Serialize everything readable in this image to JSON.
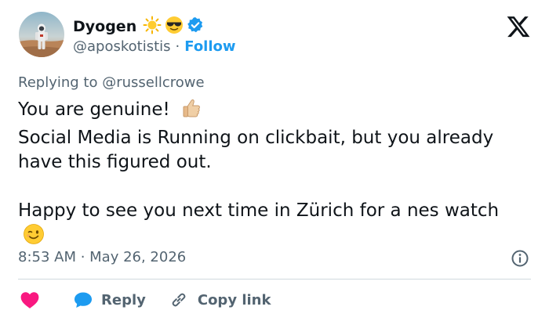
{
  "author": {
    "display_name": "Dyogen",
    "name_emojis": [
      "sun-icon",
      "sunglasses-face-icon"
    ],
    "verified": true,
    "handle": "@aposkotistis",
    "separator": "·",
    "follow_label": "Follow"
  },
  "reply_context": {
    "prefix": "Replying to",
    "mention": "@russellcrowe"
  },
  "tweet": {
    "line1": "You are genuine!",
    "line1_emoji": "thumbs-up-icon",
    "line2": "Social Media is Running on clickbait, but you already have this figured out.",
    "line3": "Happy to see you next time in Zürich for a nes watch",
    "line3_emoji": "winking-face-icon"
  },
  "timestamp": "8:53 AM · May 26, 2026",
  "actions": {
    "reply_label": "Reply",
    "copy_link_label": "Copy link"
  },
  "colors": {
    "accent": "#1d9bf0",
    "like": "#f91880",
    "muted": "#536471",
    "text": "#0f1419"
  },
  "icons": {
    "platform_logo": "x-logo-icon",
    "verified_badge": "verified-badge-icon",
    "info": "info-icon",
    "like": "heart-icon",
    "reply": "speech-bubble-icon",
    "copy_link": "link-icon"
  }
}
